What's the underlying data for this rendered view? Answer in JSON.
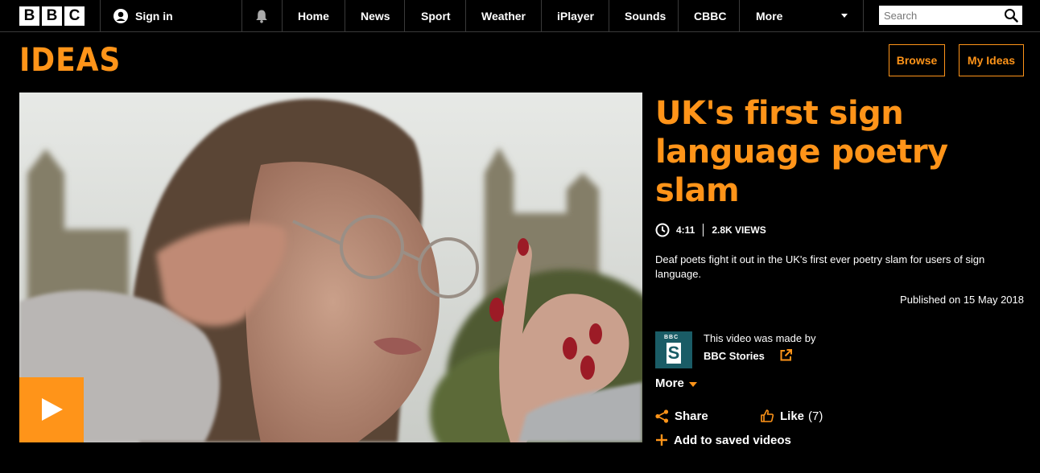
{
  "bbc_bar": {
    "logo_letters": [
      "B",
      "B",
      "C"
    ],
    "sign_in_label": "Sign in",
    "nav_items": [
      "Home",
      "News",
      "Sport",
      "Weather",
      "iPlayer",
      "Sounds",
      "CBBC",
      "More"
    ],
    "search_placeholder": "Search"
  },
  "ideas_header": {
    "logo_text": "IDEAS",
    "browse_label": "Browse",
    "my_ideas_label": "My Ideas"
  },
  "video": {
    "title": "UK's first sign language poetry slam",
    "duration": "4:11",
    "views": "2.8K VIEWS",
    "description": "Deaf poets fight it out in the UK's first ever poetry slam for users of sign language.",
    "published": "Published on 15 May 2018",
    "made_by_prefix": "This video was made by",
    "made_by_name": "BBC Stories",
    "stories_logo_top": "BBC",
    "stories_logo_letter": "S"
  },
  "actions": {
    "more_label": "More",
    "share_label": "Share",
    "like_label": "Like",
    "like_count": "(7)",
    "save_label": "Add to saved videos"
  },
  "colors": {
    "accent": "#ff9419",
    "background": "#000000",
    "stories_teal": "#1a5c66"
  },
  "icons": [
    "user-icon",
    "bell-icon",
    "search-icon",
    "clock-icon",
    "external-link-icon",
    "share-icon",
    "thumbs-up-icon",
    "plus-icon",
    "play-icon"
  ]
}
